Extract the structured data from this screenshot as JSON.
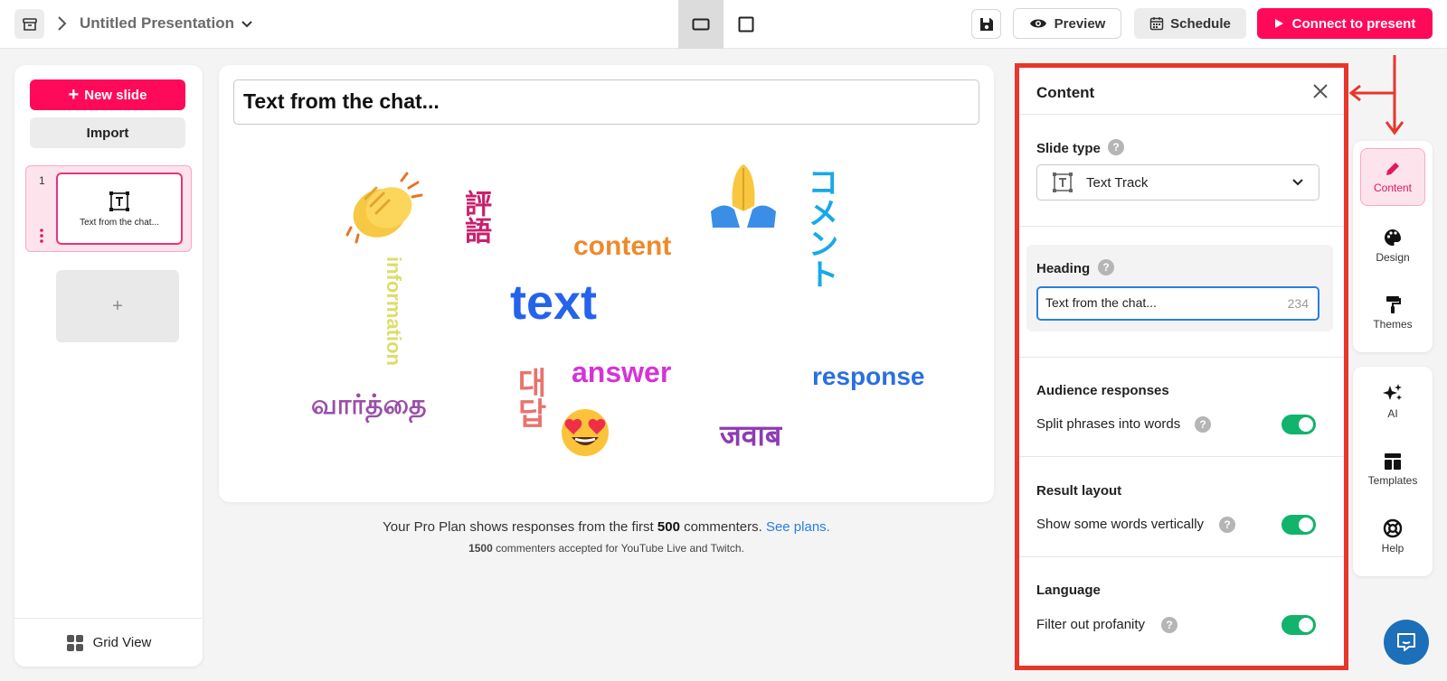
{
  "topbar": {
    "title": "Untitled Presentation",
    "preview_label": "Preview",
    "schedule_label": "Schedule",
    "connect_label": "Connect to present"
  },
  "left_panel": {
    "new_slide_label": "New slide",
    "import_label": "Import",
    "slides": [
      {
        "number": "1",
        "title": "Text from the chat..."
      }
    ],
    "add_slide_label": "+",
    "grid_view_label": "Grid View"
  },
  "canvas": {
    "heading": "Text from the chat...",
    "words": [
      {
        "text": "content",
        "color": "#ee8a2c"
      },
      {
        "text": "text",
        "color": "#2563eb"
      },
      {
        "text": "answer",
        "color": "#d633d6"
      },
      {
        "text": "response",
        "color": "#2a6fe0"
      },
      {
        "text": "information",
        "color": "#dedc6a"
      },
      {
        "text": "வார்த்தை",
        "color": "#9a4fa8"
      },
      {
        "text": "जवाब",
        "color": "#8e3bb3"
      },
      {
        "text": "評語",
        "color": "#c7206d"
      },
      {
        "text": "대답",
        "color": "#e8736e"
      },
      {
        "text": "コメント",
        "color": "#17a9e8"
      }
    ],
    "emojis": [
      "clapping-hands",
      "folded-hands",
      "heart-eyes-face"
    ]
  },
  "plan_note": {
    "prefix": "Your Pro Plan shows responses from the first ",
    "count": "500",
    "suffix": " commenters. ",
    "link": "See plans.",
    "sub_count": "1500",
    "sub_text": " commenters accepted for YouTube Live and Twitch."
  },
  "content_panel": {
    "title": "Content",
    "slide_type_label": "Slide type",
    "slide_type_value": "Text Track",
    "heading_label": "Heading",
    "heading_value": "Text from the chat...",
    "heading_remaining": "234",
    "audience_label": "Audience responses",
    "split_label": "Split phrases into words",
    "split_on": true,
    "result_layout_label": "Result layout",
    "vertical_label": "Show some words vertically",
    "vertical_on": true,
    "language_label": "Language",
    "profanity_label": "Filter out profanity",
    "profanity_on": true
  },
  "rail": {
    "top": [
      {
        "label": "Content",
        "icon": "pencil-icon",
        "active": true
      },
      {
        "label": "Design",
        "icon": "palette-icon"
      },
      {
        "label": "Themes",
        "icon": "paint-roller-icon"
      }
    ],
    "bottom": [
      {
        "label": "AI",
        "icon": "sparkles-icon"
      },
      {
        "label": "Templates",
        "icon": "layout-icon"
      },
      {
        "label": "Help",
        "icon": "lifebuoy-icon"
      }
    ]
  },
  "colors": {
    "accent": "#ff0a5b",
    "toggle_on": "#12b36b",
    "annotation": "#e8362a",
    "link": "#2b7de0"
  }
}
